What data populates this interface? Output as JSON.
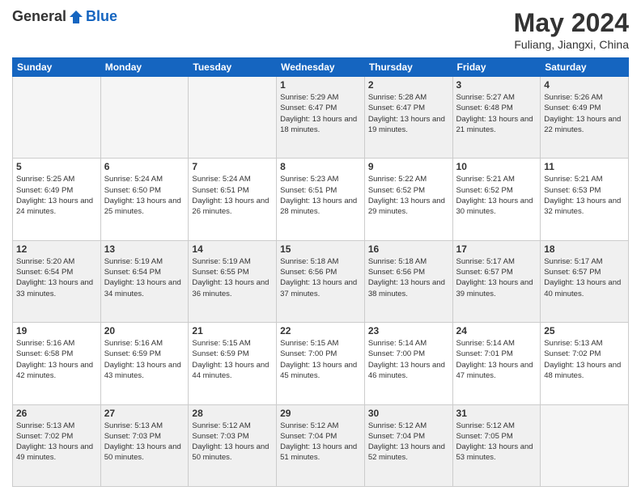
{
  "header": {
    "logo_general": "General",
    "logo_blue": "Blue",
    "month_title": "May 2024",
    "location": "Fuliang, Jiangxi, China"
  },
  "weekdays": [
    "Sunday",
    "Monday",
    "Tuesday",
    "Wednesday",
    "Thursday",
    "Friday",
    "Saturday"
  ],
  "weeks": [
    [
      {
        "day": "",
        "empty": true
      },
      {
        "day": "",
        "empty": true
      },
      {
        "day": "",
        "empty": true
      },
      {
        "day": "1",
        "sunrise": "5:29 AM",
        "sunset": "6:47 PM",
        "daylight": "13 hours and 18 minutes."
      },
      {
        "day": "2",
        "sunrise": "5:28 AM",
        "sunset": "6:47 PM",
        "daylight": "13 hours and 19 minutes."
      },
      {
        "day": "3",
        "sunrise": "5:27 AM",
        "sunset": "6:48 PM",
        "daylight": "13 hours and 21 minutes."
      },
      {
        "day": "4",
        "sunrise": "5:26 AM",
        "sunset": "6:49 PM",
        "daylight": "13 hours and 22 minutes."
      }
    ],
    [
      {
        "day": "5",
        "sunrise": "5:25 AM",
        "sunset": "6:49 PM",
        "daylight": "13 hours and 24 minutes."
      },
      {
        "day": "6",
        "sunrise": "5:24 AM",
        "sunset": "6:50 PM",
        "daylight": "13 hours and 25 minutes."
      },
      {
        "day": "7",
        "sunrise": "5:24 AM",
        "sunset": "6:51 PM",
        "daylight": "13 hours and 26 minutes."
      },
      {
        "day": "8",
        "sunrise": "5:23 AM",
        "sunset": "6:51 PM",
        "daylight": "13 hours and 28 minutes."
      },
      {
        "day": "9",
        "sunrise": "5:22 AM",
        "sunset": "6:52 PM",
        "daylight": "13 hours and 29 minutes."
      },
      {
        "day": "10",
        "sunrise": "5:21 AM",
        "sunset": "6:52 PM",
        "daylight": "13 hours and 30 minutes."
      },
      {
        "day": "11",
        "sunrise": "5:21 AM",
        "sunset": "6:53 PM",
        "daylight": "13 hours and 32 minutes."
      }
    ],
    [
      {
        "day": "12",
        "sunrise": "5:20 AM",
        "sunset": "6:54 PM",
        "daylight": "13 hours and 33 minutes."
      },
      {
        "day": "13",
        "sunrise": "5:19 AM",
        "sunset": "6:54 PM",
        "daylight": "13 hours and 34 minutes."
      },
      {
        "day": "14",
        "sunrise": "5:19 AM",
        "sunset": "6:55 PM",
        "daylight": "13 hours and 36 minutes."
      },
      {
        "day": "15",
        "sunrise": "5:18 AM",
        "sunset": "6:56 PM",
        "daylight": "13 hours and 37 minutes."
      },
      {
        "day": "16",
        "sunrise": "5:18 AM",
        "sunset": "6:56 PM",
        "daylight": "13 hours and 38 minutes."
      },
      {
        "day": "17",
        "sunrise": "5:17 AM",
        "sunset": "6:57 PM",
        "daylight": "13 hours and 39 minutes."
      },
      {
        "day": "18",
        "sunrise": "5:17 AM",
        "sunset": "6:57 PM",
        "daylight": "13 hours and 40 minutes."
      }
    ],
    [
      {
        "day": "19",
        "sunrise": "5:16 AM",
        "sunset": "6:58 PM",
        "daylight": "13 hours and 42 minutes."
      },
      {
        "day": "20",
        "sunrise": "5:16 AM",
        "sunset": "6:59 PM",
        "daylight": "13 hours and 43 minutes."
      },
      {
        "day": "21",
        "sunrise": "5:15 AM",
        "sunset": "6:59 PM",
        "daylight": "13 hours and 44 minutes."
      },
      {
        "day": "22",
        "sunrise": "5:15 AM",
        "sunset": "7:00 PM",
        "daylight": "13 hours and 45 minutes."
      },
      {
        "day": "23",
        "sunrise": "5:14 AM",
        "sunset": "7:00 PM",
        "daylight": "13 hours and 46 minutes."
      },
      {
        "day": "24",
        "sunrise": "5:14 AM",
        "sunset": "7:01 PM",
        "daylight": "13 hours and 47 minutes."
      },
      {
        "day": "25",
        "sunrise": "5:13 AM",
        "sunset": "7:02 PM",
        "daylight": "13 hours and 48 minutes."
      }
    ],
    [
      {
        "day": "26",
        "sunrise": "5:13 AM",
        "sunset": "7:02 PM",
        "daylight": "13 hours and 49 minutes."
      },
      {
        "day": "27",
        "sunrise": "5:13 AM",
        "sunset": "7:03 PM",
        "daylight": "13 hours and 50 minutes."
      },
      {
        "day": "28",
        "sunrise": "5:12 AM",
        "sunset": "7:03 PM",
        "daylight": "13 hours and 50 minutes."
      },
      {
        "day": "29",
        "sunrise": "5:12 AM",
        "sunset": "7:04 PM",
        "daylight": "13 hours and 51 minutes."
      },
      {
        "day": "30",
        "sunrise": "5:12 AM",
        "sunset": "7:04 PM",
        "daylight": "13 hours and 52 minutes."
      },
      {
        "day": "31",
        "sunrise": "5:12 AM",
        "sunset": "7:05 PM",
        "daylight": "13 hours and 53 minutes."
      },
      {
        "day": "",
        "empty": true
      }
    ]
  ]
}
